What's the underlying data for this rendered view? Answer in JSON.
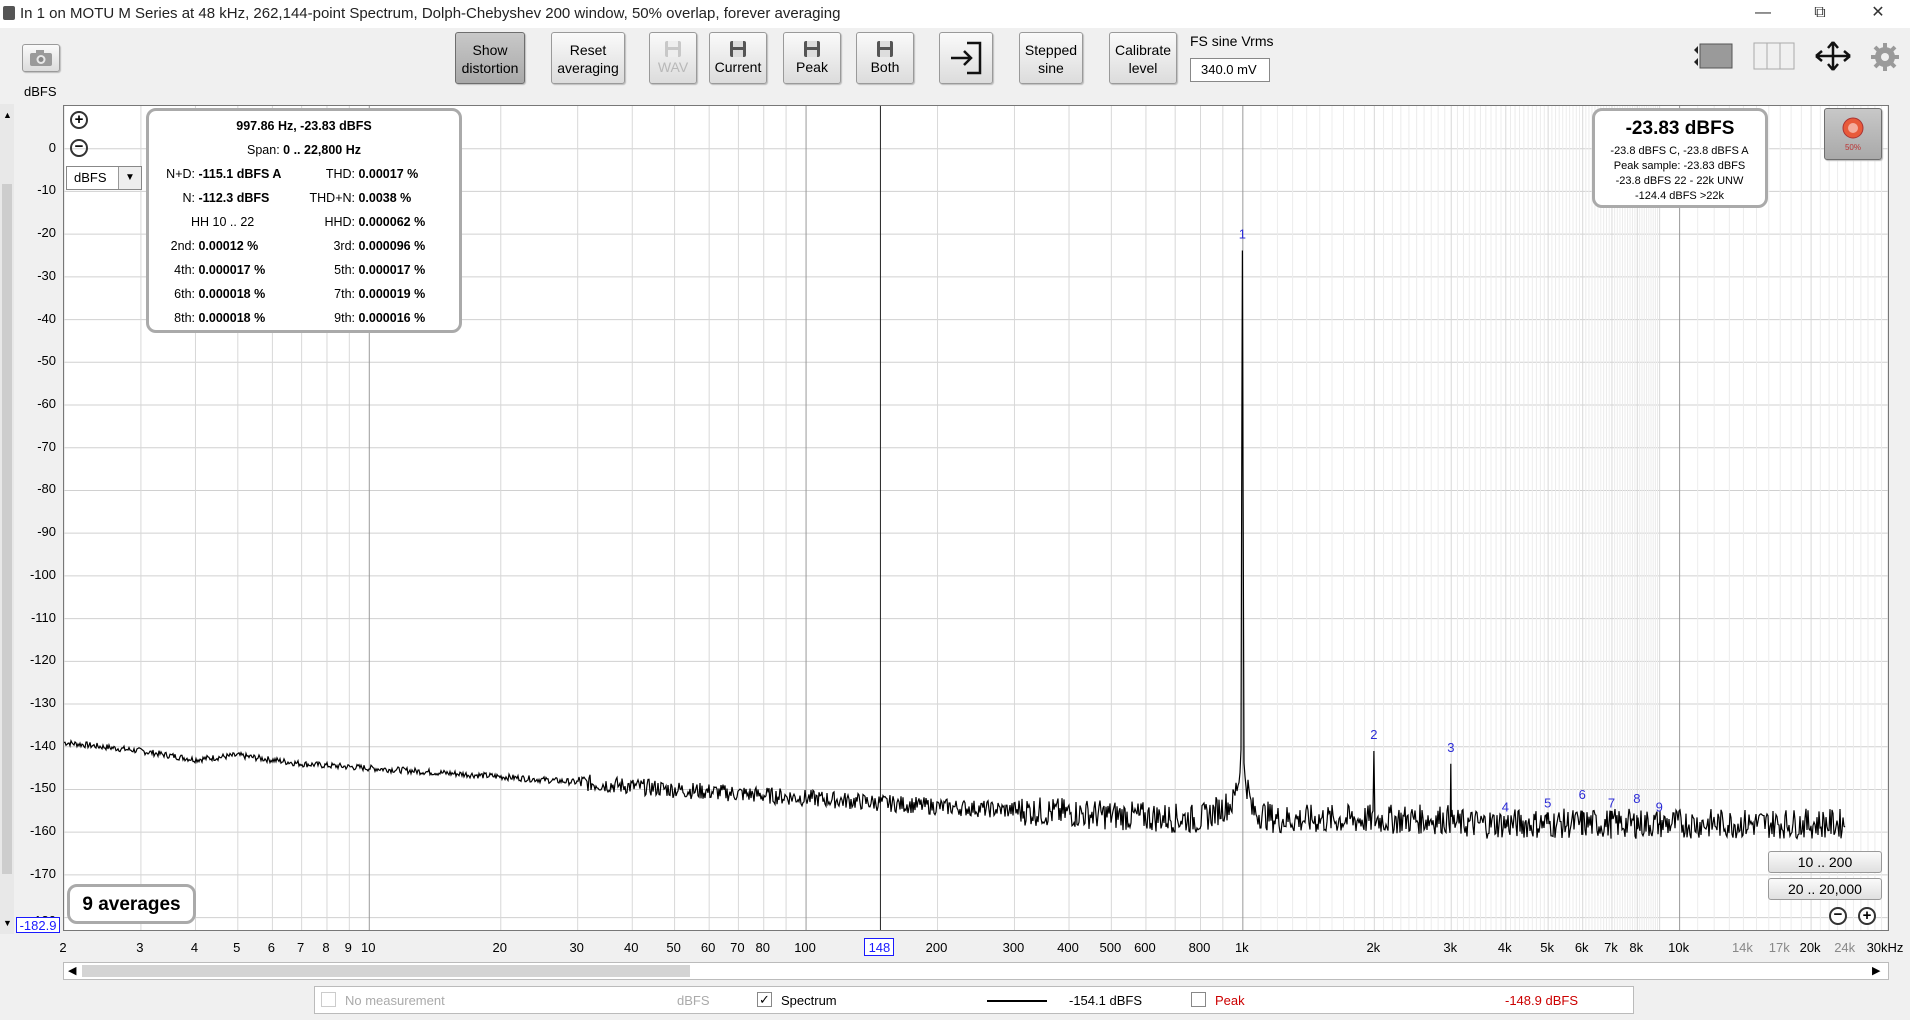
{
  "window": {
    "title": "In 1 on MOTU M Series at 48 kHz, 262,144-point Spectrum, Dolph-Chebyshev 200 window, 50% overlap, forever averaging",
    "controls": [
      "—",
      "⧉",
      "✕"
    ]
  },
  "toolbar": {
    "show_distortion": [
      "Show",
      "distortion"
    ],
    "reset_averaging": [
      "Reset",
      "averaging"
    ],
    "wav": "WAV",
    "current": "Current",
    "peak": "Peak",
    "both": "Both",
    "stepped_sine": [
      "Stepped",
      "sine"
    ],
    "calibrate_level": [
      "Calibrate",
      "level"
    ],
    "fs_label": "FS sine Vrms",
    "fs_value": "340.0 mV"
  },
  "axes": {
    "y_unit": "dBFS",
    "y_ticks": [
      "0",
      "-10",
      "-20",
      "-30",
      "-40",
      "-50",
      "-60",
      "-70",
      "-80",
      "-90",
      "-100",
      "-110",
      "-120",
      "-130",
      "-140",
      "-150",
      "-160",
      "-170",
      "-180"
    ],
    "y_bottom_value": "-182.9",
    "y_selector": "dBFS",
    "x_ticks": [
      "2",
      "3",
      "4",
      "5",
      "6",
      "7",
      "8",
      "9",
      "10",
      "20",
      "30",
      "40",
      "50",
      "60",
      "70",
      "80",
      "100",
      "200",
      "300",
      "400",
      "500",
      "600",
      "800",
      "1k",
      "2k",
      "3k",
      "4k",
      "5k",
      "6k",
      "7k",
      "8k",
      "10k",
      "14k",
      "17k",
      "20k",
      "24k",
      "30kHz"
    ],
    "cursor_value": "148"
  },
  "distortion_panel": {
    "header": "997.86 Hz, -23.83 dBFS",
    "span_label": "Span:",
    "span_value": "0 .. 22,800 Hz",
    "rows": [
      [
        {
          "k": "N+D:",
          "v": "-115.1 dBFS A"
        },
        {
          "k": "THD:",
          "v": "0.00017 %"
        }
      ],
      [
        {
          "k": "N:",
          "v": "-112.3 dBFS"
        },
        {
          "k": "THD+N:",
          "v": "0.0038 %"
        }
      ],
      [
        {
          "k": "HH 10 .. 22",
          "v": ""
        },
        {
          "k": "HHD:",
          "v": "0.000062 %"
        }
      ],
      [
        {
          "k": "2nd:",
          "v": "0.00012 %"
        },
        {
          "k": "3rd:",
          "v": "0.000096 %"
        }
      ],
      [
        {
          "k": "4th:",
          "v": "0.000017 %"
        },
        {
          "k": "5th:",
          "v": "0.000017 %"
        }
      ],
      [
        {
          "k": "6th:",
          "v": "0.000018 %"
        },
        {
          "k": "7th:",
          "v": "0.000019 %"
        }
      ],
      [
        {
          "k": "8th:",
          "v": "0.000018 %"
        },
        {
          "k": "9th:",
          "v": "0.000016 %"
        }
      ]
    ]
  },
  "level_panel": {
    "main": "-23.83 dBFS",
    "lines": [
      "-23.8 dBFS C, -23.8 dBFS A",
      "Peak sample: -23.83 dBFS",
      "-23.8 dBFS 22 - 22k UNW",
      "-124.4 dBFS >22k"
    ]
  },
  "record_button": {
    "label": "50%"
  },
  "averages": "9 averages",
  "zoom_presets": [
    "10 .. 200",
    "20 .. 20,000"
  ],
  "harmonic_markers": [
    "1",
    "2",
    "3",
    "4",
    "5",
    "6",
    "7",
    "8",
    "9"
  ],
  "legend": {
    "no_measurement": "No measurement",
    "no_measurement_value": "dBFS",
    "spectrum_label": "Spectrum",
    "spectrum_checked": true,
    "spectrum_value": "-154.1 dBFS",
    "peak_label": "Peak",
    "peak_checked": false,
    "peak_value": "-148.9 dBFS"
  },
  "colors": {
    "trace": "#000000",
    "harmonic_marker": "#2b2bd6",
    "peak_text": "#cc0000",
    "cursor_label": "#1a1aff"
  },
  "chart_data": {
    "type": "line",
    "x_scale": "log",
    "xlim": [
      2,
      30000
    ],
    "ylim": [
      -182.9,
      10
    ],
    "ylabel": "dBFS",
    "series": [
      {
        "name": "Spectrum",
        "x": [
          2,
          3,
          4,
          5,
          7,
          10,
          20,
          50,
          100,
          200,
          500,
          800,
          950,
          990,
          997.86,
          1005,
          1050,
          1200,
          1995,
          2000,
          2005,
          2995,
          3000,
          3005,
          4000,
          6000,
          10000,
          20000,
          24000
        ],
        "y": [
          -139,
          -141,
          -143,
          -142,
          -144,
          -145,
          -147,
          -150,
          -152,
          -154,
          -156,
          -157,
          -153,
          -145,
          -23.83,
          -145,
          -155,
          -157,
          -157,
          -141,
          -157,
          -157,
          -144,
          -158,
          -158,
          -158,
          -158,
          -158,
          -158
        ]
      }
    ],
    "harmonics": [
      {
        "n": 1,
        "freq": 997.86,
        "level": -23.83
      },
      {
        "n": 2,
        "freq": 1995.7,
        "level": -141
      },
      {
        "n": 3,
        "freq": 2993.6,
        "level": -144
      },
      {
        "n": 4,
        "freq": 3991.4,
        "level": -158
      },
      {
        "n": 5,
        "freq": 4989.3,
        "level": -157
      },
      {
        "n": 6,
        "freq": 5987.2,
        "level": -155
      },
      {
        "n": 7,
        "freq": 6985.0,
        "level": -157
      },
      {
        "n": 8,
        "freq": 7982.9,
        "level": -156
      },
      {
        "n": 9,
        "freq": 8980.7,
        "level": -158
      }
    ]
  }
}
